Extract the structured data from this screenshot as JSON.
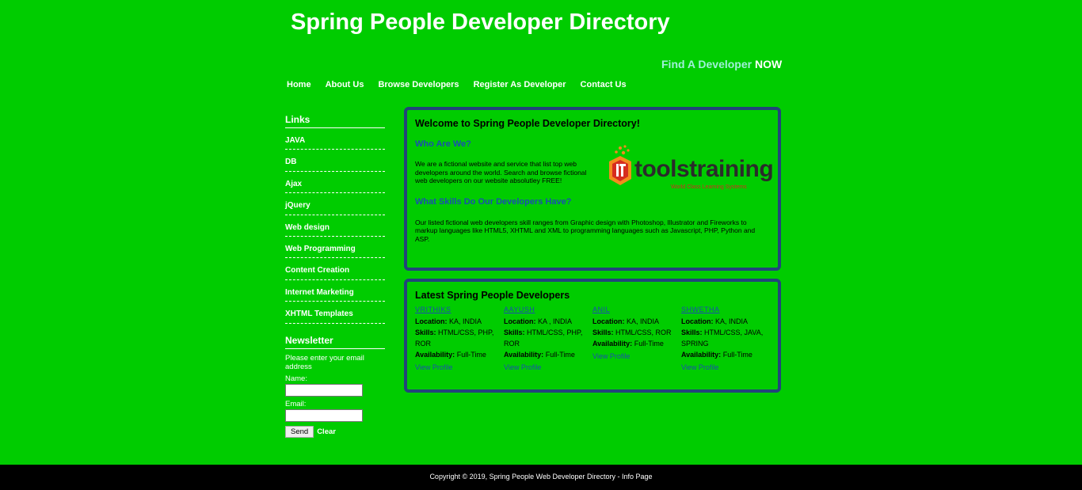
{
  "header": {
    "title": "Spring People Developer Directory",
    "tagline_main": "Find A Developer",
    "tagline_now": "NOW"
  },
  "nav": {
    "home": "Home",
    "about": "About Us",
    "browse": "Browse Developers",
    "register": "Register As Developer",
    "contact": "Contact Us"
  },
  "sidebar": {
    "links_heading": "Links",
    "links": [
      "JAVA",
      "DB",
      "Ajax",
      "jQuery",
      "Web design",
      "Web Programming",
      "Content Creation",
      "Internet Marketing",
      "XHTML Templates"
    ],
    "newsletter_heading": "Newsletter",
    "newsletter_text": "Please enter your email address",
    "name_label": "Name:",
    "email_label": "Email:",
    "send_label": "Send",
    "clear_label": "Clear"
  },
  "welcome": {
    "title": "Welcome to Spring People Developer Directory!",
    "who_heading": "Who Are We?",
    "who_text": "We are a fictional website and service that list top web developers around the world. Search and browse fictional web developers on our website absolutley FREE!",
    "skills_heading": "What Skills Do Our Developers Have?",
    "skills_text": "Our listed fictional web developers skill ranges from Graphic design with Photoshop, Illustrator and Fireworks to markup languages like HTML5, XHTML and XML to programming languages such as Javascript, PHP, Python and ASP.",
    "logo_text": "toolstraining",
    "logo_sub": "World Class Learning Systems"
  },
  "latest": {
    "title": "Latest Spring People Developers",
    "location_label": "Location:",
    "skills_label": "Skills:",
    "availability_label": "Availability:",
    "view_label": "View Profile",
    "developers": [
      {
        "name": "VRITHIKS",
        "location": "KA, INDIA",
        "skills": "HTML/CSS, PHP, ROR",
        "availability": "Full-Time"
      },
      {
        "name": "AAYUSH",
        "location": "KA , INDIA",
        "skills": "HTML/CSS, PHP, ROR",
        "availability": "Full-Time"
      },
      {
        "name": "ANIL",
        "location": "KA, INDIA",
        "skills": "HTML/CSS, ROR",
        "availability": "Full-Time"
      },
      {
        "name": "SHWETHA",
        "location": "KA, INDIA",
        "skills": "HTML/CSS, JAVA, SPRING",
        "availability": "Full-Time"
      }
    ]
  },
  "footer": {
    "text": "Copyright © 2019, Spring People Web Developer Directory - Info Page"
  },
  "colors": {
    "background": "#00cc00",
    "box_border": "#22447a",
    "heading_blue": "#1a4fb0",
    "logo_orange": "#f28c1e",
    "logo_red": "#d62d1f"
  }
}
